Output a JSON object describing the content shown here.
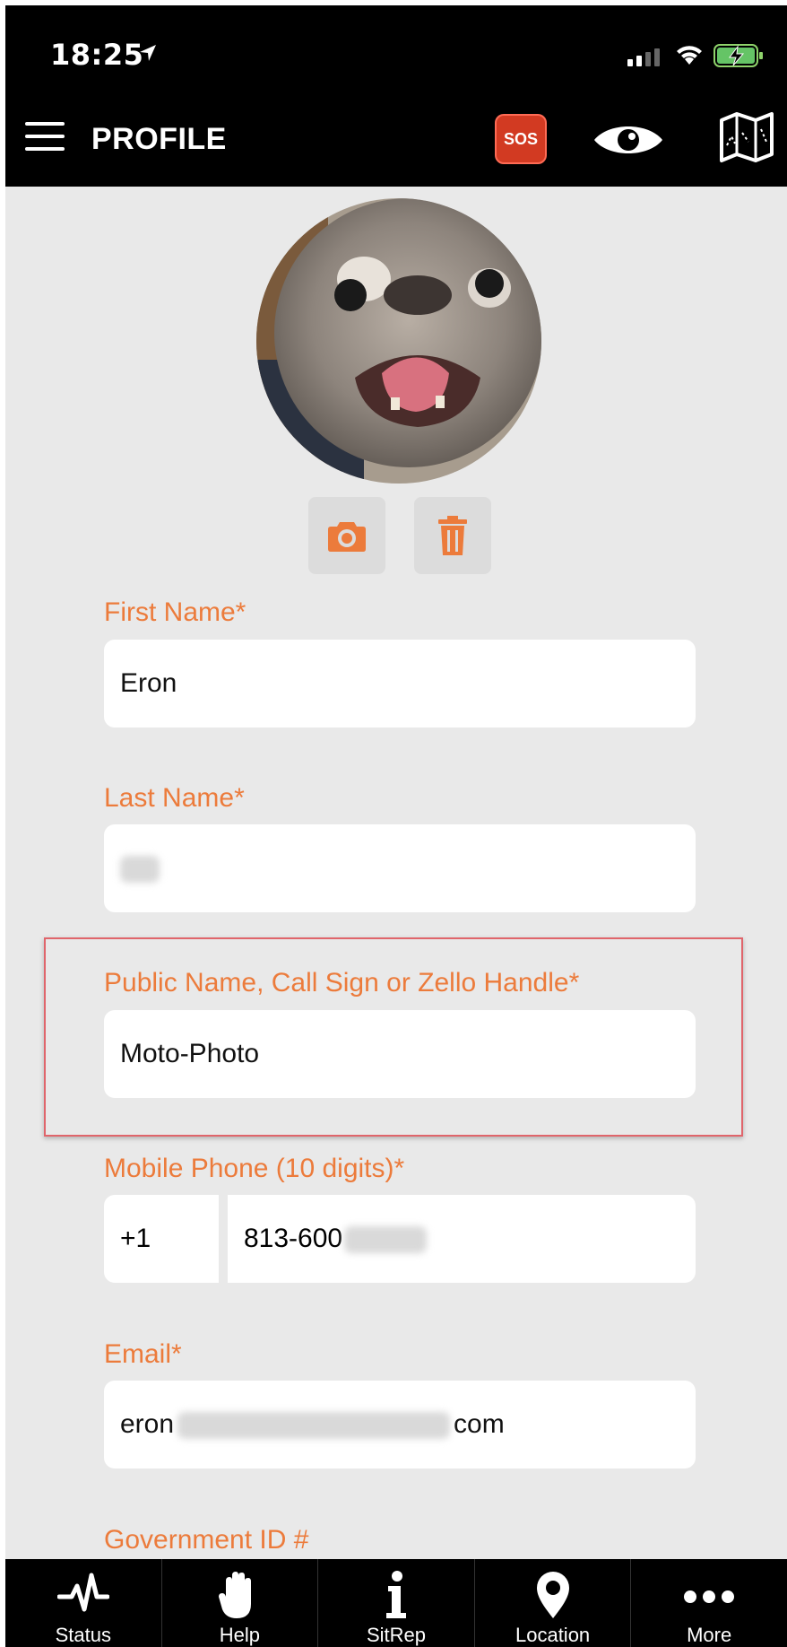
{
  "status_bar": {
    "time": "18:25"
  },
  "header": {
    "title": "PROFILE",
    "sos_label": "SOS"
  },
  "form": {
    "first_name": {
      "label": "First Name*",
      "value": "Eron"
    },
    "last_name": {
      "label": "Last Name*",
      "value": ""
    },
    "public_name": {
      "label": "Public Name, Call Sign or Zello Handle*",
      "value": "Moto-Photo"
    },
    "mobile_phone": {
      "label": "Mobile Phone (10 digits)*",
      "country_code": "+1",
      "number_visible": "813-600"
    },
    "email": {
      "label": "Email*",
      "prefix": "eron",
      "suffix": "com"
    },
    "government_id": {
      "label": "Government ID #"
    }
  },
  "tabbar": {
    "items": [
      {
        "label": "Status",
        "icon": "heartbeat-icon"
      },
      {
        "label": "Help",
        "icon": "hand-icon"
      },
      {
        "label": "SitRep",
        "icon": "info-icon"
      },
      {
        "label": "Location",
        "icon": "map-pin-icon"
      },
      {
        "label": "More",
        "icon": "ellipsis-icon"
      }
    ]
  },
  "colors": {
    "accent": "#ec7b3b",
    "sos": "#d23a22",
    "header_bg": "#000000",
    "page_bg": "#e9e9e9",
    "highlight": "#e0656b"
  }
}
